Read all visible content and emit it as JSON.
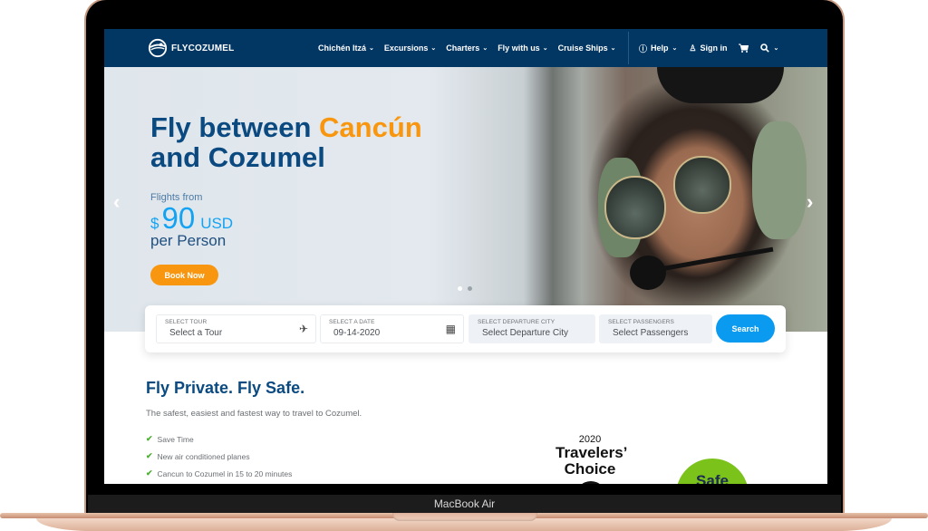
{
  "device": {
    "label": "MacBook Air"
  },
  "nav": {
    "brand": "FLYCOZUMEL",
    "menu": [
      {
        "label": "Chichén Itzá",
        "icon": "chevron-down-icon"
      },
      {
        "label": "Excursions",
        "icon": "chevron-down-icon"
      },
      {
        "label": "Charters",
        "icon": "chevron-down-icon"
      },
      {
        "label": "Fly with us",
        "icon": "chevron-down-icon"
      },
      {
        "label": "Cruise Ships",
        "icon": "chevron-down-icon"
      }
    ],
    "utility": {
      "help": "Help",
      "signin": "Sign in",
      "cart_icon": "cart-icon",
      "search_icon": "search-icon"
    },
    "glyphs": {
      "caret": "⌄",
      "help": "ⓘ",
      "user": "♙",
      "cart": "🛒",
      "search": "⚲"
    }
  },
  "hero": {
    "title_prefix": "Fly between ",
    "title_accent": "Cancún",
    "title_line2": "and Cozumel",
    "flights_from": "Flights from",
    "currency_symbol": "$",
    "price": "90",
    "currency": "USD",
    "per": "per Person",
    "cta": "Book Now",
    "arrows": {
      "prev": "‹",
      "next": "›"
    },
    "slides": {
      "count": 2,
      "active": 1
    },
    "colors": {
      "title": "#0b4a80",
      "accent": "#f8970f",
      "price": "#13a3f2"
    }
  },
  "search": {
    "fields": [
      {
        "label": "SELECT TOUR",
        "value": "Select a Tour",
        "icon": "✈"
      },
      {
        "label": "SELECT A DATE",
        "value": "09-14-2020",
        "icon": "▦"
      },
      {
        "label": "SELECT DEPARTURE CITY",
        "value": "Select Departure City"
      },
      {
        "label": "SELECT PASSENGERS",
        "value": "Select Passengers"
      }
    ],
    "button": "Search"
  },
  "content": {
    "title": "Fly Private. Fly Safe.",
    "subtitle": "The safest, easiest and fastest way to travel to Cozumel.",
    "features": [
      "Save Time",
      "New air conditioned planes",
      "Cancun to Cozumel in 15 to 20 minutes"
    ],
    "check_glyph": "✔",
    "award": {
      "year": "2020",
      "line1": "Travelers’",
      "line2": "Choice"
    },
    "safe_badge": "Safe"
  }
}
